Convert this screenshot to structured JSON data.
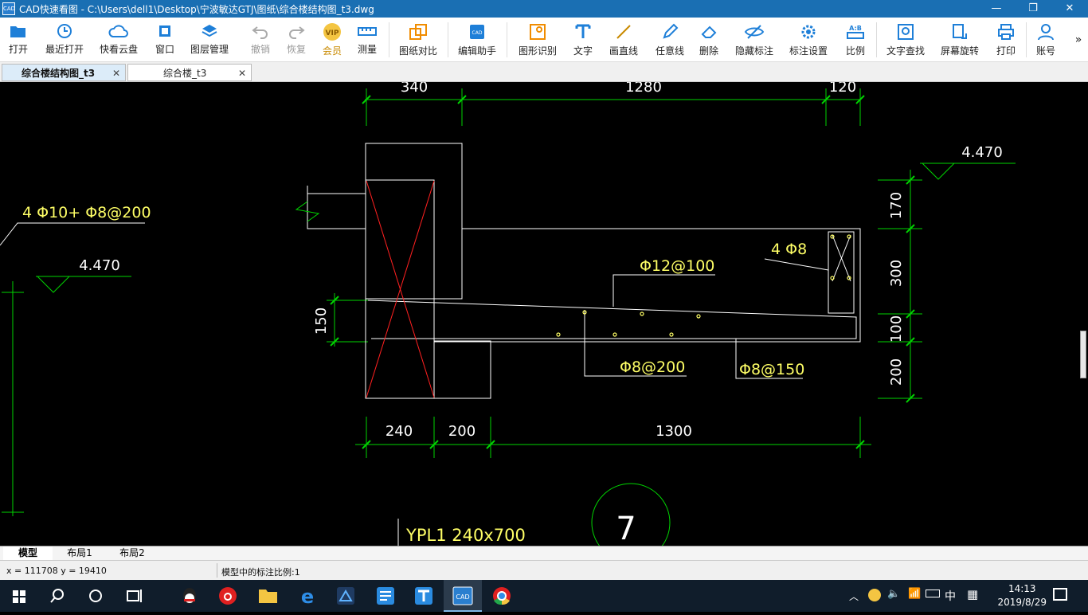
{
  "window": {
    "title": "CAD快速看图 - C:\\Users\\dell1\\Desktop\\宁波敏达GTJ\\图纸\\综合楼结构图_t3.dwg",
    "app_icon_text": "CAD",
    "minimize": "—",
    "maximize": "❐",
    "close": "✕"
  },
  "toolbar": {
    "items": [
      {
        "label": "打开",
        "icon": "folder-open-icon"
      },
      {
        "label": "最近打开",
        "icon": "recent-clock-icon"
      },
      {
        "label": "快看云盘",
        "icon": "cloud-icon"
      },
      {
        "label": "窗口",
        "icon": "window-fit-icon"
      },
      {
        "label": "图层管理",
        "icon": "layers-icon"
      },
      {
        "label": "撤销",
        "icon": "undo-icon",
        "disabled": true
      },
      {
        "label": "恢复",
        "icon": "redo-icon",
        "disabled": true
      },
      {
        "label": "会员",
        "icon": "vip-icon",
        "vip_text": "VIP"
      },
      {
        "label": "测量",
        "icon": "ruler-icon"
      },
      {
        "label": "图纸对比",
        "icon": "compare-icon"
      },
      {
        "label": "编辑助手",
        "icon": "edit-assistant-icon"
      },
      {
        "label": "图形识别",
        "icon": "shape-recognize-icon"
      },
      {
        "label": "文字",
        "icon": "text-icon"
      },
      {
        "label": "画直线",
        "icon": "line-icon"
      },
      {
        "label": "任意线",
        "icon": "pen-icon"
      },
      {
        "label": "删除",
        "icon": "eraser-icon"
      },
      {
        "label": "隐藏标注",
        "icon": "eye-hide-icon"
      },
      {
        "label": "标注设置",
        "icon": "gear-icon"
      },
      {
        "label": "比例",
        "icon": "scale-icon",
        "scale_text": "A:B"
      },
      {
        "label": "文字查找",
        "icon": "text-search-icon"
      },
      {
        "label": "屏幕旋转",
        "icon": "rotate-icon"
      },
      {
        "label": "打印",
        "icon": "printer-icon"
      },
      {
        "label": "账号",
        "icon": "user-icon"
      }
    ],
    "more": "»"
  },
  "tabs": [
    {
      "label": "综合楼结构图_t3",
      "active": true
    },
    {
      "label": "综合楼_t3",
      "active": false
    }
  ],
  "drawing": {
    "dims_top": [
      "340",
      "1280",
      "120"
    ],
    "dims_bottom": [
      "240",
      "200",
      "1300"
    ],
    "dims_right": [
      "170",
      "300",
      "100",
      "200"
    ],
    "dim_left": "150",
    "elev_right": "4.470",
    "elev_left": "4.470",
    "rebar_left": "4 Φ10+ Φ8@200",
    "rebar_top": "Φ12@100",
    "rebar_corner": "4 Φ8",
    "rebar_bottom1": "Φ8@200",
    "rebar_bottom2": "Φ8@150",
    "beam_label": "YPL1 240x700",
    "detail_number": "7",
    "colors": {
      "dim": "#00d400",
      "text": "#ffff66",
      "line": "#ffffff",
      "cross": "#ff2020"
    }
  },
  "layout_tabs": [
    "模型",
    "布局1",
    "布局2"
  ],
  "status": {
    "coords": "x = 111708  y = 19410",
    "scale": "模型中的标注比例:1"
  },
  "taskbar": {
    "time": "14:13",
    "date": "2019/8/29",
    "ime": "中",
    "icons": [
      "windows-start-icon",
      "search-icon",
      "cortana-icon",
      "task-view-icon",
      "qq-icon",
      "netease-music-icon",
      "file-explorer-icon",
      "edge-icon",
      "app-icon",
      "news-icon",
      "text-app-icon",
      "cad-app-icon",
      "chrome-icon"
    ]
  }
}
